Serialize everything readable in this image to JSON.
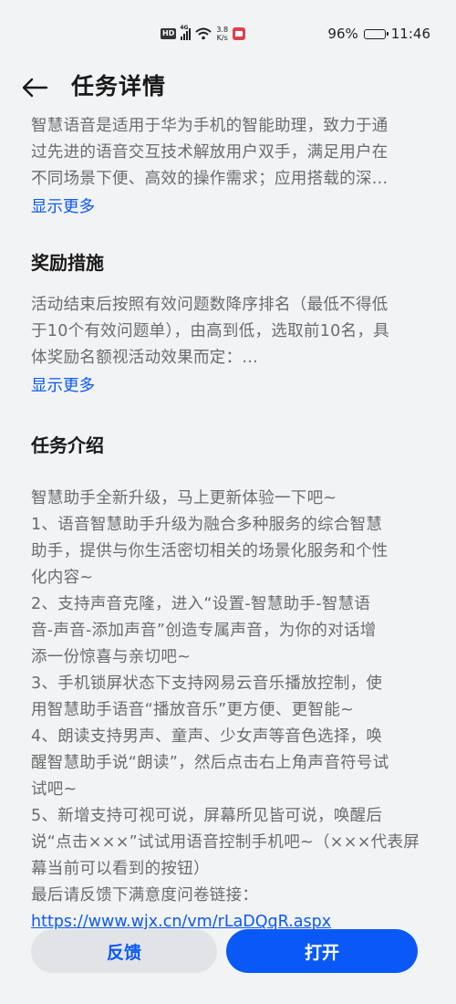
{
  "status_bar": {
    "hd_badge": "HD",
    "network": "4G",
    "speed_value": "3.8",
    "speed_unit": "K/s",
    "battery": "96%",
    "battery_level": 0.96,
    "time": "11:46"
  },
  "header": {
    "back_icon": "arrow-left-icon",
    "title": "任务详情"
  },
  "intro": {
    "lines": [
      "智慧语音是适用于华为手机的智能助理，致力于通",
      "过先进的语音交互技术解放用户双手，满足用户在",
      "不同场景下便、高效的操作需求；应用搭载的深..."
    ],
    "show_more": "显示更多"
  },
  "reward": {
    "title": "奖励措施",
    "lines": [
      "活动结束后按照有效问题数降序排名（最低不得低",
      "于10个有效问题单），由高到低，选取前10名，具",
      "体奖励名额视活动效果而定：..."
    ],
    "show_more": "显示更多"
  },
  "task_intro": {
    "title": "任务介绍",
    "lines": [
      "智慧助手全新升级，马上更新体验一下吧~",
      "1、语音智慧助手升级为融合多种服务的综合智慧",
      "助手，提供与你生活密切相关的场景化服务和个性",
      "化内容~",
      "2、支持声音克隆，进入“设置-智慧助手-智慧语",
      "音-声音-添加声音”创造专属声音，为你的对话增",
      "添一份惊喜与亲切吧~",
      "3、手机锁屏状态下支持网易云音乐播放控制，使",
      "用智慧助手语音“播放音乐”更方便、更智能~",
      "4、朗读支持男声、童声、少女声等音色选择，唤",
      "醒智慧助手说“朗读”，然后点击右上角声音符号试",
      "试吧~",
      "5、新增支持可视可说，屏幕所见皆可说，唤醒后",
      "说“点击×××”试试用语音控制手机吧~（×××代表屏",
      "幕当前可以看到的按钮）",
      "最后请反馈下满意度问卷链接："
    ],
    "link": "https://www.wjx.cn/vm/rLaDQqR.aspx"
  },
  "buttons": {
    "feedback": "反馈",
    "open": "打开"
  },
  "colors": {
    "accent": "#0a59f7",
    "background": "#f2f3f5",
    "body_text": "#6b6b6b"
  }
}
